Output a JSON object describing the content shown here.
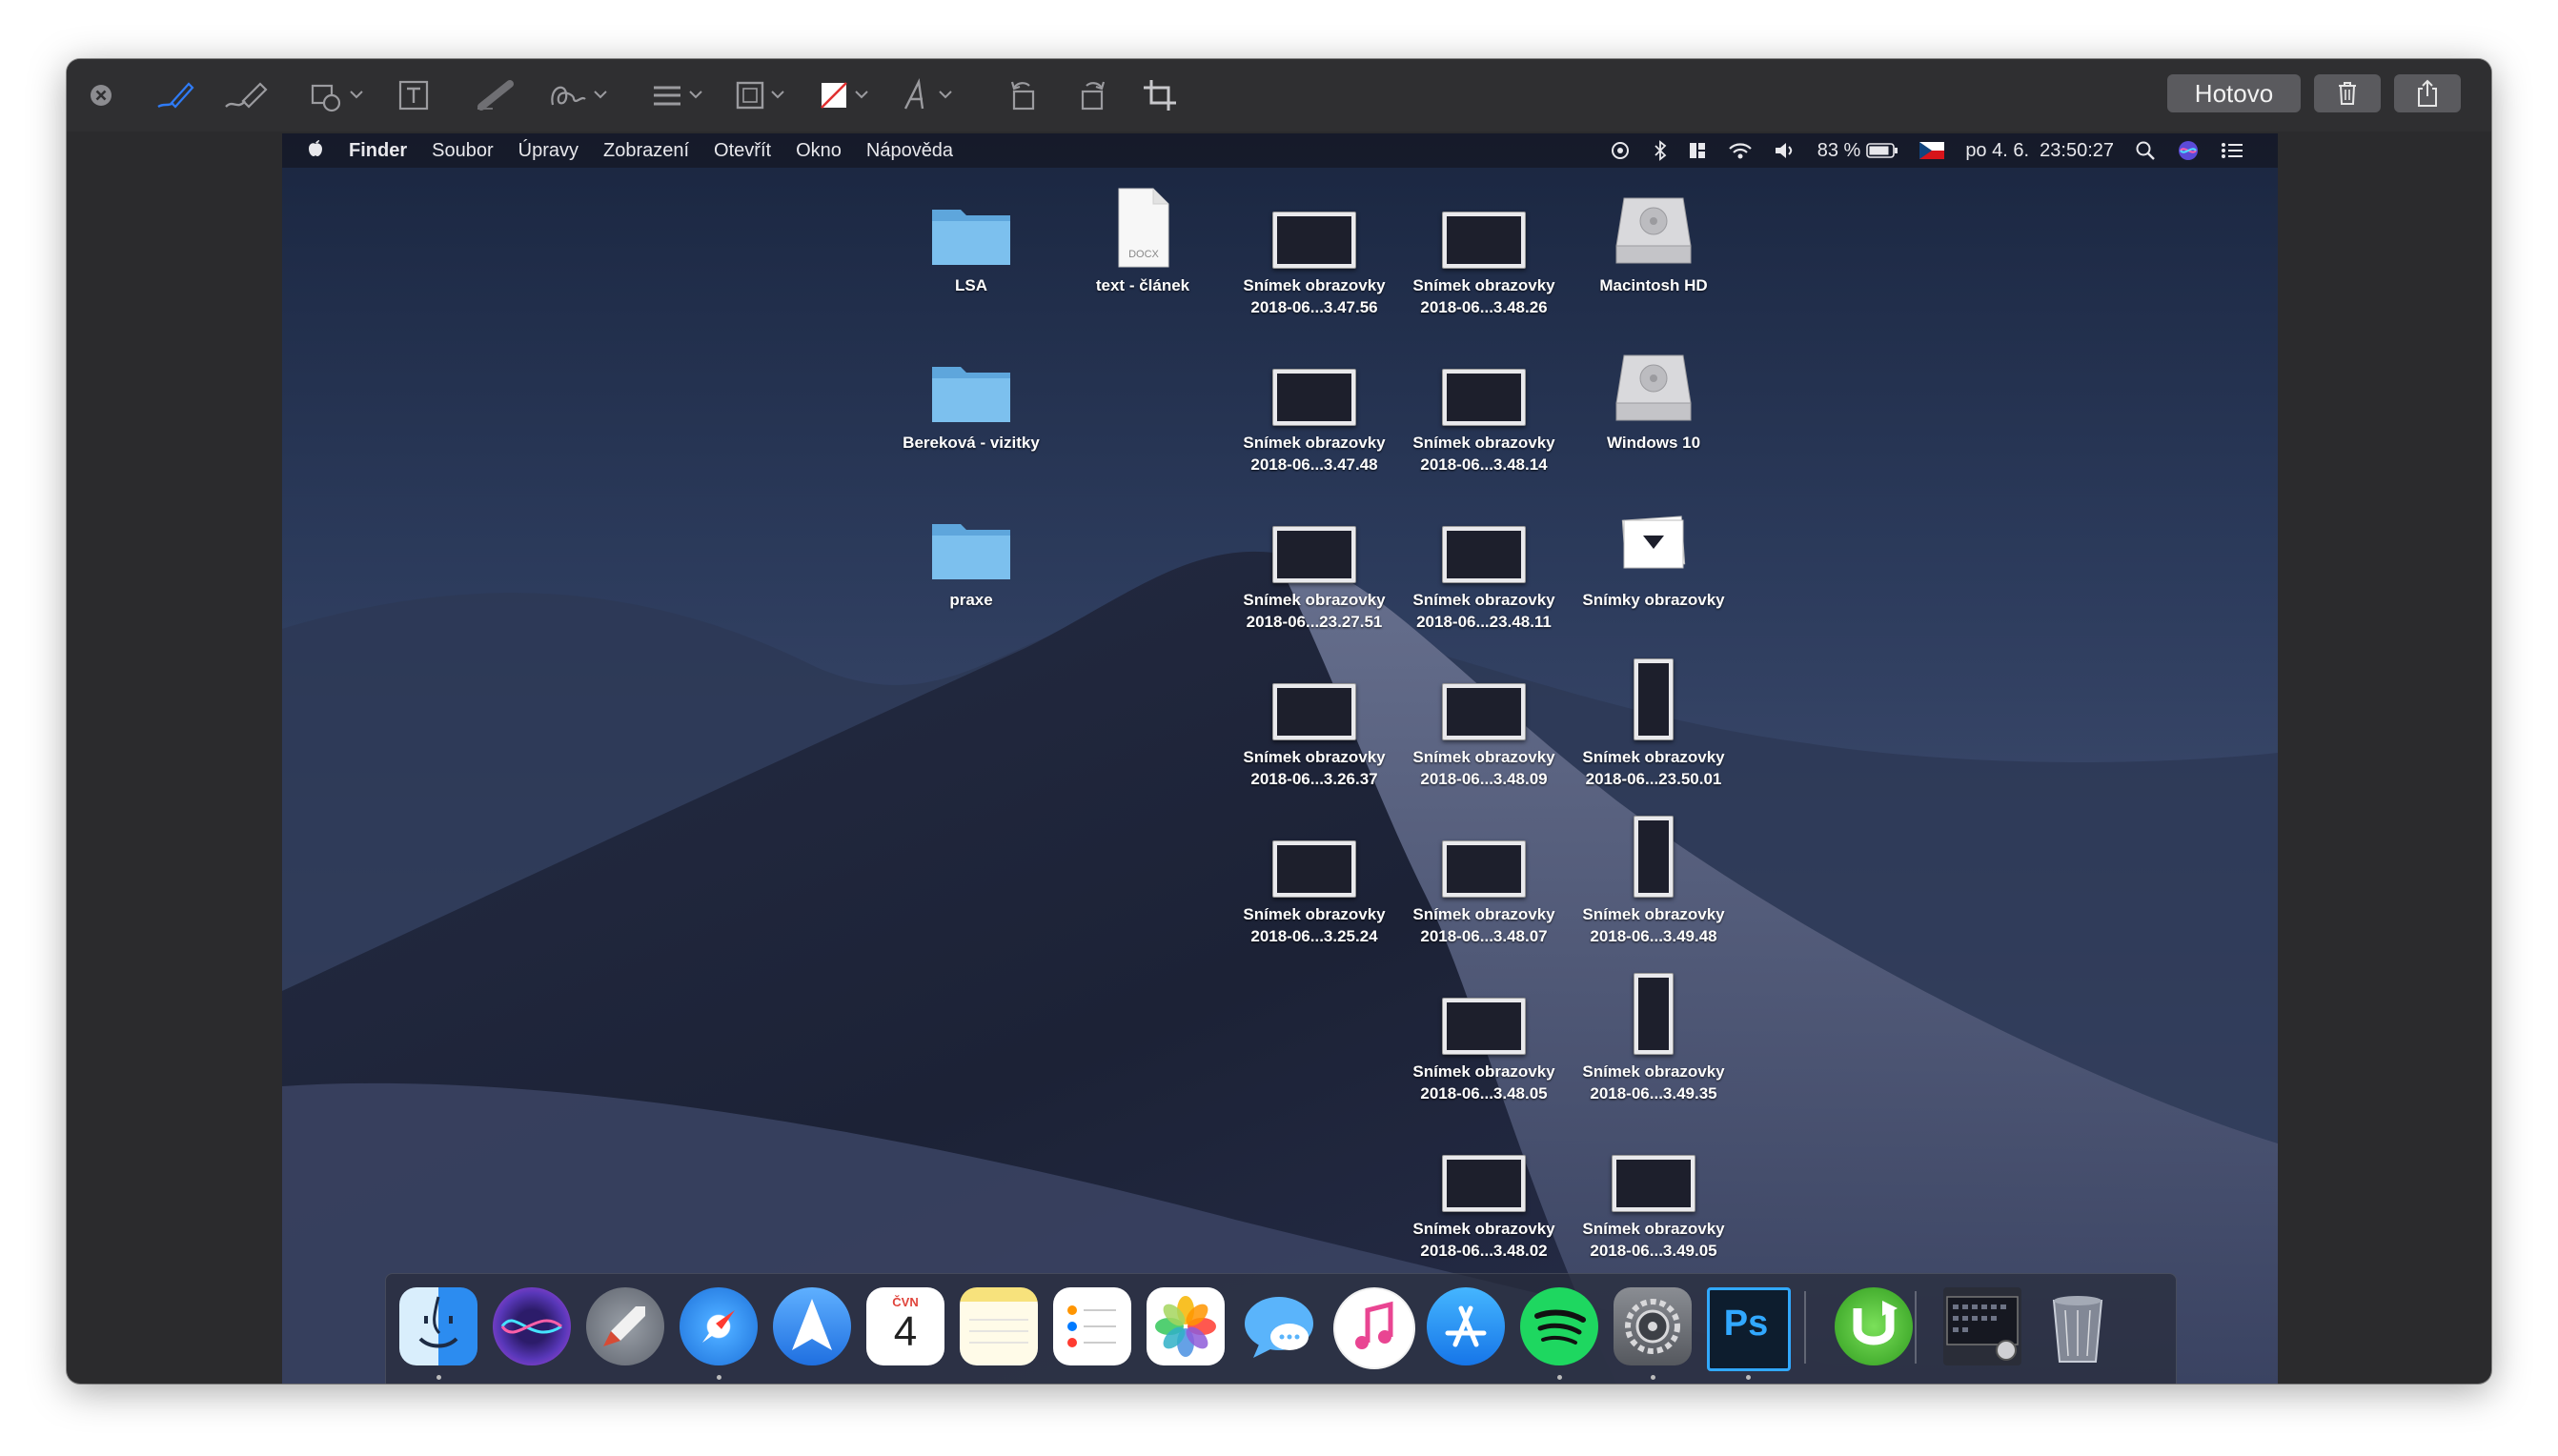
{
  "toolbar": {
    "done_label": "Hotovo"
  },
  "menubar": {
    "app_name": "Finder",
    "menus": [
      "Soubor",
      "Úpravy",
      "Zobrazení",
      "Otevřít",
      "Okno",
      "Nápověda"
    ],
    "battery": "83 %",
    "datetime": "po 4. 6.  23:50:27"
  },
  "desktop": {
    "icons": [
      {
        "label1": "LSA",
        "label2": "",
        "kind": "folder"
      },
      {
        "label1": "text - článek",
        "label2": "",
        "kind": "docx"
      },
      {
        "label1": "Snímek obrazovky",
        "label2": "2018-06...3.47.56",
        "kind": "shot"
      },
      {
        "label1": "Snímek obrazovky",
        "label2": "2018-06...3.48.26",
        "kind": "shot"
      },
      {
        "label1": "Macintosh HD",
        "label2": "",
        "kind": "disk"
      },
      {
        "label1": "Bereková - vizitky",
        "label2": "",
        "kind": "folder"
      },
      {
        "label1": "Snímek obrazovky",
        "label2": "2018-06...3.47.48",
        "kind": "shot"
      },
      {
        "label1": "Snímek obrazovky",
        "label2": "2018-06...3.48.14",
        "kind": "shot"
      },
      {
        "label1": "Windows 10",
        "label2": "",
        "kind": "disk"
      },
      {
        "label1": "praxe",
        "label2": "",
        "kind": "folder"
      },
      {
        "label1": "Snímek obrazovky",
        "label2": "2018-06...23.27.51",
        "kind": "shot"
      },
      {
        "label1": "Snímek obrazovky",
        "label2": "2018-06...23.48.11",
        "kind": "shot"
      },
      {
        "label1": "Snímky obrazovky",
        "label2": "",
        "kind": "stack"
      },
      {
        "label1": "Snímek obrazovky",
        "label2": "2018-06...3.26.37",
        "kind": "shot"
      },
      {
        "label1": "Snímek obrazovky",
        "label2": "2018-06...3.48.09",
        "kind": "shot"
      },
      {
        "label1": "Snímek obrazovky",
        "label2": "2018-06...23.50.01",
        "kind": "tall"
      },
      {
        "label1": "Snímek obrazovky",
        "label2": "2018-06...3.25.24",
        "kind": "shot"
      },
      {
        "label1": "Snímek obrazovky",
        "label2": "2018-06...3.48.07",
        "kind": "shot"
      },
      {
        "label1": "Snímek obrazovky",
        "label2": "2018-06...3.49.48",
        "kind": "tall"
      },
      {
        "label1": "Snímek obrazovky",
        "label2": "2018-06...3.48.05",
        "kind": "shot"
      },
      {
        "label1": "Snímek obrazovky",
        "label2": "2018-06...3.49.35",
        "kind": "tall"
      },
      {
        "label1": "Snímek obrazovky",
        "label2": "2018-06...3.48.02",
        "kind": "shot"
      },
      {
        "label1": "Snímek obrazovky",
        "label2": "2018-06...3.49.05",
        "kind": "shot"
      }
    ]
  },
  "dock": {
    "calendar_month": "ČVN",
    "calendar_day": "4",
    "photoshop_label": "Ps",
    "apps": [
      "finder-icon",
      "siri-icon",
      "launchpad-icon",
      "safari-icon",
      "spark-mail-icon",
      "calendar-icon",
      "notes-icon",
      "reminders-icon",
      "photos-icon",
      "messages-icon",
      "itunes-icon",
      "app-store-icon",
      "spotify-icon",
      "system-preferences-icon",
      "photoshop-icon",
      "utorrent-icon",
      "screenshots-stack-icon",
      "trash-icon"
    ]
  },
  "colors": {
    "window_bg": "#2b2b2d",
    "accent_pen": "#2f7bf5",
    "folder_blue": "#6fb4e6",
    "hotovo_bg": "#5a5a5e"
  }
}
